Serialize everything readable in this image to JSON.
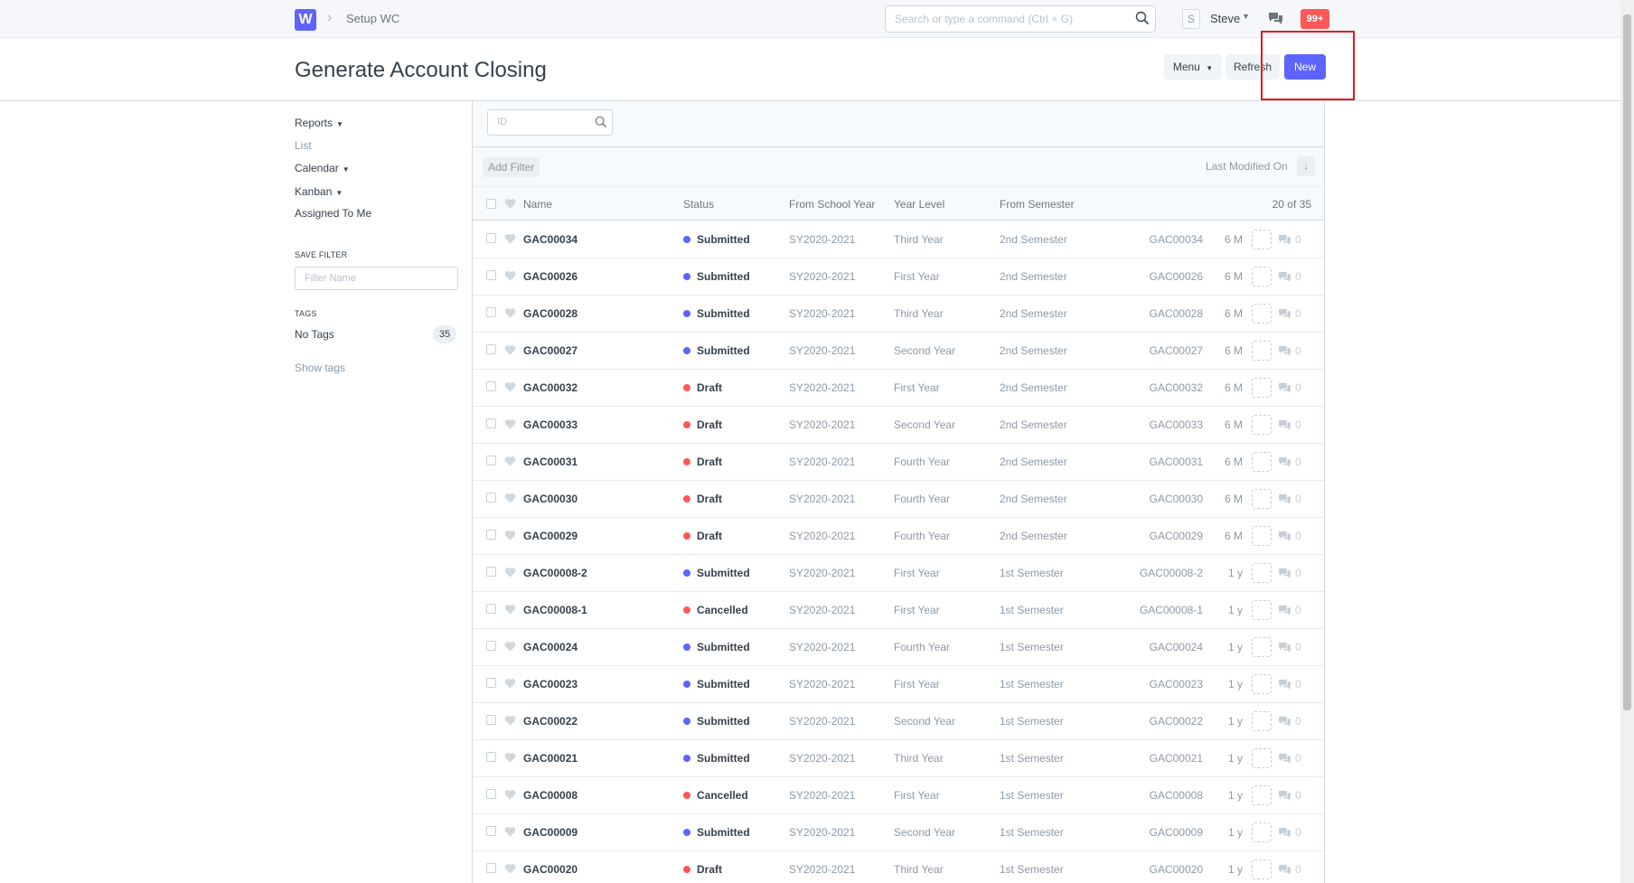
{
  "navbar": {
    "logo_letter": "W",
    "breadcrumb": "Setup WC",
    "search_placeholder": "Search or type a command (Ctrl + G)",
    "avatar_letter": "S",
    "user_name": "Steve",
    "notifications": "99+"
  },
  "header": {
    "title": "Generate Account Closing",
    "menu_label": "Menu",
    "refresh_label": "Refresh",
    "new_label": "New"
  },
  "sidebar": {
    "reports": "Reports",
    "list": "List",
    "calendar": "Calendar",
    "kanban": "Kanban",
    "assigned_to_me": "Assigned To Me",
    "save_filter_heading": "SAVE FILTER",
    "filter_name_placeholder": "Filter Name",
    "tags_heading": "TAGS",
    "no_tags": "No Tags",
    "no_tags_count": "35",
    "show_tags": "Show tags"
  },
  "list": {
    "id_placeholder": "ID",
    "add_filter": "Add Filter",
    "sort_label": "Last Modified On",
    "columns": {
      "name": "Name",
      "status": "Status",
      "from_school_year": "From School Year",
      "year_level": "Year Level",
      "from_semester": "From Semester",
      "count": "20 of 35"
    },
    "status_colors": {
      "Submitted": "#5e64ff",
      "Draft": "#ff5858",
      "Cancelled": "#ff5858"
    },
    "rows": [
      {
        "name": "GAC00034",
        "status": "Submitted",
        "school_year": "SY2020-2021",
        "year_level": "Third Year",
        "semester": "2nd Semester",
        "id": "GAC00034",
        "modified": "6 M",
        "comments": "0"
      },
      {
        "name": "GAC00026",
        "status": "Submitted",
        "school_year": "SY2020-2021",
        "year_level": "First Year",
        "semester": "2nd Semester",
        "id": "GAC00026",
        "modified": "6 M",
        "comments": "0"
      },
      {
        "name": "GAC00028",
        "status": "Submitted",
        "school_year": "SY2020-2021",
        "year_level": "Third Year",
        "semester": "2nd Semester",
        "id": "GAC00028",
        "modified": "6 M",
        "comments": "0"
      },
      {
        "name": "GAC00027",
        "status": "Submitted",
        "school_year": "SY2020-2021",
        "year_level": "Second Year",
        "semester": "2nd Semester",
        "id": "GAC00027",
        "modified": "6 M",
        "comments": "0"
      },
      {
        "name": "GAC00032",
        "status": "Draft",
        "school_year": "SY2020-2021",
        "year_level": "First Year",
        "semester": "2nd Semester",
        "id": "GAC00032",
        "modified": "6 M",
        "comments": "0"
      },
      {
        "name": "GAC00033",
        "status": "Draft",
        "school_year": "SY2020-2021",
        "year_level": "Second Year",
        "semester": "2nd Semester",
        "id": "GAC00033",
        "modified": "6 M",
        "comments": "0"
      },
      {
        "name": "GAC00031",
        "status": "Draft",
        "school_year": "SY2020-2021",
        "year_level": "Fourth Year",
        "semester": "2nd Semester",
        "id": "GAC00031",
        "modified": "6 M",
        "comments": "0"
      },
      {
        "name": "GAC00030",
        "status": "Draft",
        "school_year": "SY2020-2021",
        "year_level": "Fourth Year",
        "semester": "2nd Semester",
        "id": "GAC00030",
        "modified": "6 M",
        "comments": "0"
      },
      {
        "name": "GAC00029",
        "status": "Draft",
        "school_year": "SY2020-2021",
        "year_level": "Fourth Year",
        "semester": "2nd Semester",
        "id": "GAC00029",
        "modified": "6 M",
        "comments": "0"
      },
      {
        "name": "GAC00008-2",
        "status": "Submitted",
        "school_year": "SY2020-2021",
        "year_level": "First Year",
        "semester": "1st Semester",
        "id": "GAC00008-2",
        "modified": "1 y",
        "comments": "0"
      },
      {
        "name": "GAC00008-1",
        "status": "Cancelled",
        "school_year": "SY2020-2021",
        "year_level": "First Year",
        "semester": "1st Semester",
        "id": "GAC00008-1",
        "modified": "1 y",
        "comments": "0"
      },
      {
        "name": "GAC00024",
        "status": "Submitted",
        "school_year": "SY2020-2021",
        "year_level": "Fourth Year",
        "semester": "1st Semester",
        "id": "GAC00024",
        "modified": "1 y",
        "comments": "0"
      },
      {
        "name": "GAC00023",
        "status": "Submitted",
        "school_year": "SY2020-2021",
        "year_level": "First Year",
        "semester": "1st Semester",
        "id": "GAC00023",
        "modified": "1 y",
        "comments": "0"
      },
      {
        "name": "GAC00022",
        "status": "Submitted",
        "school_year": "SY2020-2021",
        "year_level": "Second Year",
        "semester": "1st Semester",
        "id": "GAC00022",
        "modified": "1 y",
        "comments": "0"
      },
      {
        "name": "GAC00021",
        "status": "Submitted",
        "school_year": "SY2020-2021",
        "year_level": "Third Year",
        "semester": "1st Semester",
        "id": "GAC00021",
        "modified": "1 y",
        "comments": "0"
      },
      {
        "name": "GAC00008",
        "status": "Cancelled",
        "school_year": "SY2020-2021",
        "year_level": "First Year",
        "semester": "1st Semester",
        "id": "GAC00008",
        "modified": "1 y",
        "comments": "0"
      },
      {
        "name": "GAC00009",
        "status": "Submitted",
        "school_year": "SY2020-2021",
        "year_level": "Second Year",
        "semester": "1st Semester",
        "id": "GAC00009",
        "modified": "1 y",
        "comments": "0"
      },
      {
        "name": "GAC00020",
        "status": "Draft",
        "school_year": "SY2020-2021",
        "year_level": "Third Year",
        "semester": "1st Semester",
        "id": "GAC00020",
        "modified": "1 y",
        "comments": "0"
      }
    ]
  },
  "annotation": {
    "highlight_color": "#e01b1b"
  }
}
